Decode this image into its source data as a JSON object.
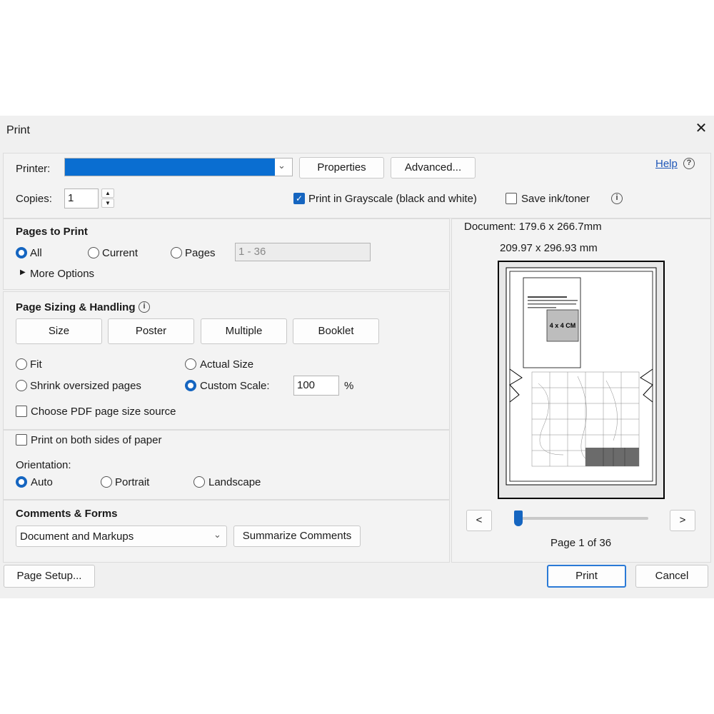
{
  "dialog": {
    "title": "Print"
  },
  "header": {
    "printer_label": "Printer:",
    "properties_label": "Properties",
    "advanced_label": "Advanced...",
    "help_label": "Help",
    "copies_label": "Copies:",
    "copies_value": "1",
    "grayscale_label": "Print in Grayscale (black and white)",
    "grayscale_checked": true,
    "save_ink_label": "Save ink/toner",
    "save_ink_checked": false
  },
  "pages_to_print": {
    "heading": "Pages to Print",
    "all_label": "All",
    "current_label": "Current",
    "pages_label": "Pages",
    "pages_placeholder": "1 - 36",
    "selected": "All",
    "more_options_label": "More Options"
  },
  "sizing": {
    "heading": "Page Sizing & Handling",
    "tabs": [
      "Size",
      "Poster",
      "Multiple",
      "Booklet"
    ],
    "fit_label": "Fit",
    "actual_size_label": "Actual Size",
    "shrink_label": "Shrink oversized pages",
    "custom_scale_label": "Custom Scale:",
    "custom_scale_value": "100",
    "percent_label": "%",
    "selected": "Custom Scale",
    "pdf_source_label": "Choose PDF page size source",
    "pdf_source_checked": false
  },
  "duplex": {
    "both_sides_label": "Print on both sides of paper",
    "both_sides_checked": false,
    "orientation_label": "Orientation:",
    "auto_label": "Auto",
    "portrait_label": "Portrait",
    "landscape_label": "Landscape",
    "selected": "Auto"
  },
  "comments": {
    "heading": "Comments & Forms",
    "selected_option": "Document and Markups",
    "summarize_label": "Summarize Comments"
  },
  "preview": {
    "document_size": "Document: 179.6 x 266.7mm",
    "paper_size": "209.97 x 296.93 mm",
    "box_label": "4 x 4 CM",
    "prev_label": "<",
    "next_label": ">",
    "page_indicator": "Page 1 of 36",
    "current_page": 1,
    "total_pages": 36
  },
  "footer": {
    "page_setup_label": "Page Setup...",
    "print_label": "Print",
    "cancel_label": "Cancel"
  },
  "colors": {
    "accent": "#1565c0",
    "printer_field": "#0a6ed1"
  }
}
